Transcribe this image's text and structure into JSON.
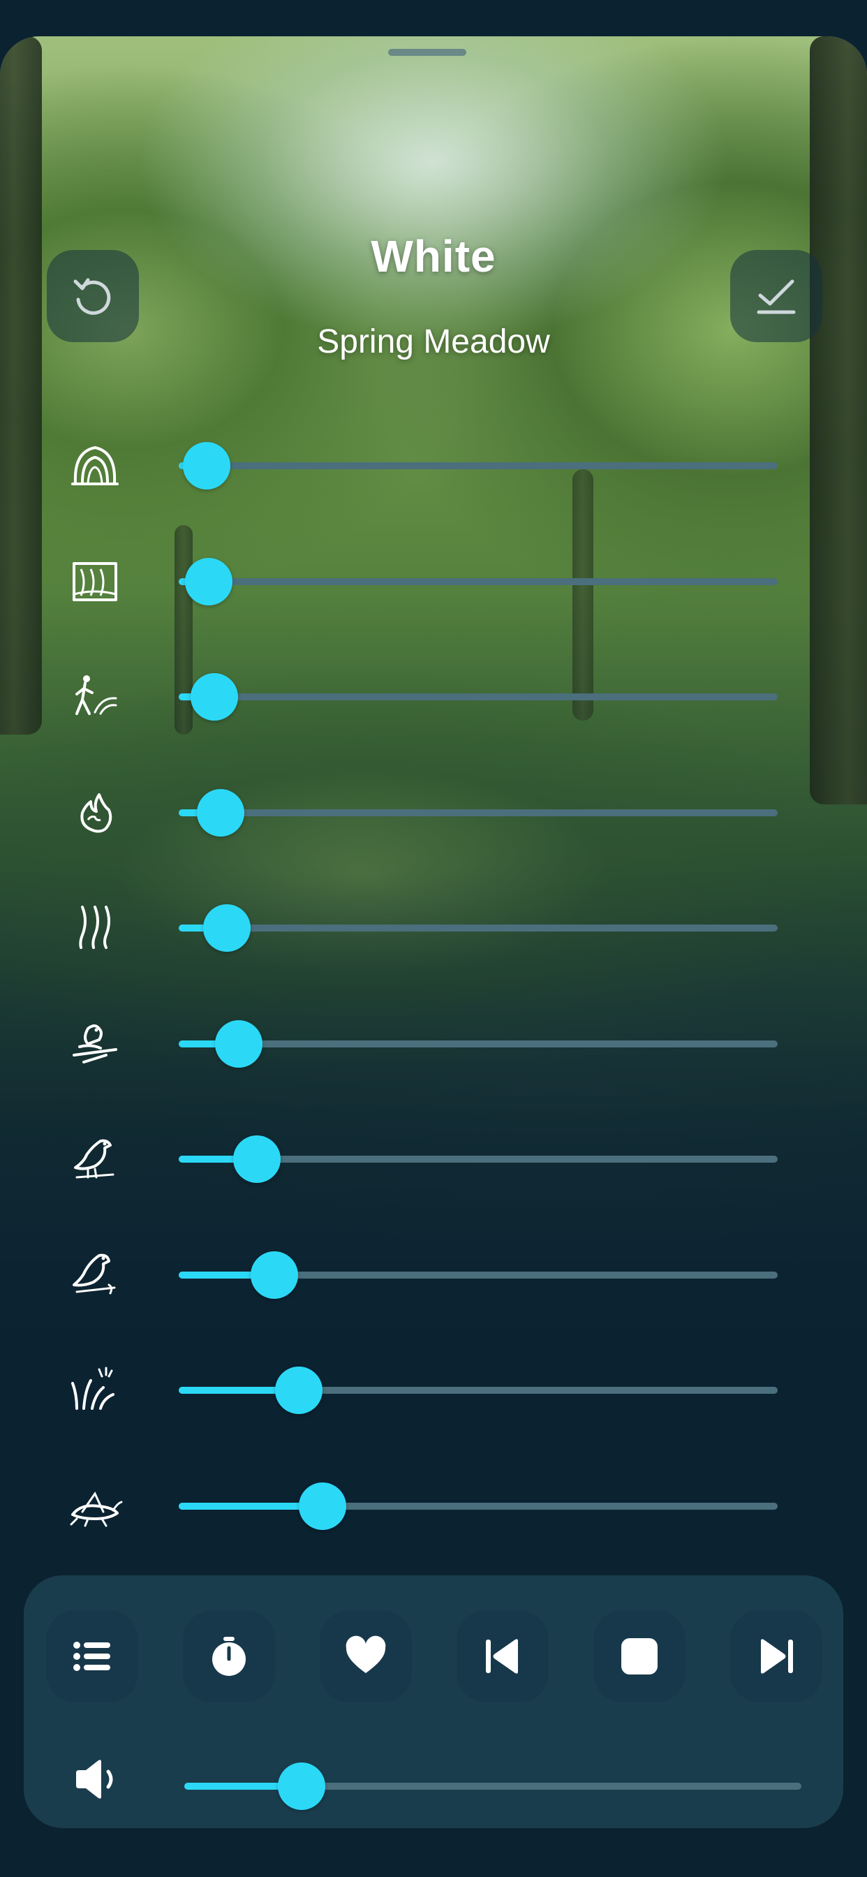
{
  "header": {
    "title": "White",
    "subtitle": "Spring Meadow",
    "reset_icon": "reset-icon",
    "confirm_icon": "check-icon"
  },
  "mixer": {
    "accent_color": "#2bd9f7",
    "track_color": "#4b6f7c",
    "sounds": [
      {
        "icon": "cave-icon",
        "level": 0.04
      },
      {
        "icon": "waterfall-icon",
        "level": 0.05
      },
      {
        "icon": "creek-hiker-icon",
        "level": 0.06
      },
      {
        "icon": "fire-icon",
        "level": 0.07
      },
      {
        "icon": "stream-icon",
        "level": 0.08
      },
      {
        "icon": "birds-branch-icon",
        "level": 0.1
      },
      {
        "icon": "songbird-icon",
        "level": 0.13
      },
      {
        "icon": "bird-perched-icon",
        "level": 0.16
      },
      {
        "icon": "grass-icon",
        "level": 0.2
      },
      {
        "icon": "cricket-icon",
        "level": 0.24
      }
    ]
  },
  "controls": {
    "buttons": [
      "list-icon",
      "timer-icon",
      "heart-icon",
      "previous-icon",
      "stop-icon",
      "next-icon"
    ],
    "volume_icon": "speaker-icon",
    "volume": 0.19
  }
}
